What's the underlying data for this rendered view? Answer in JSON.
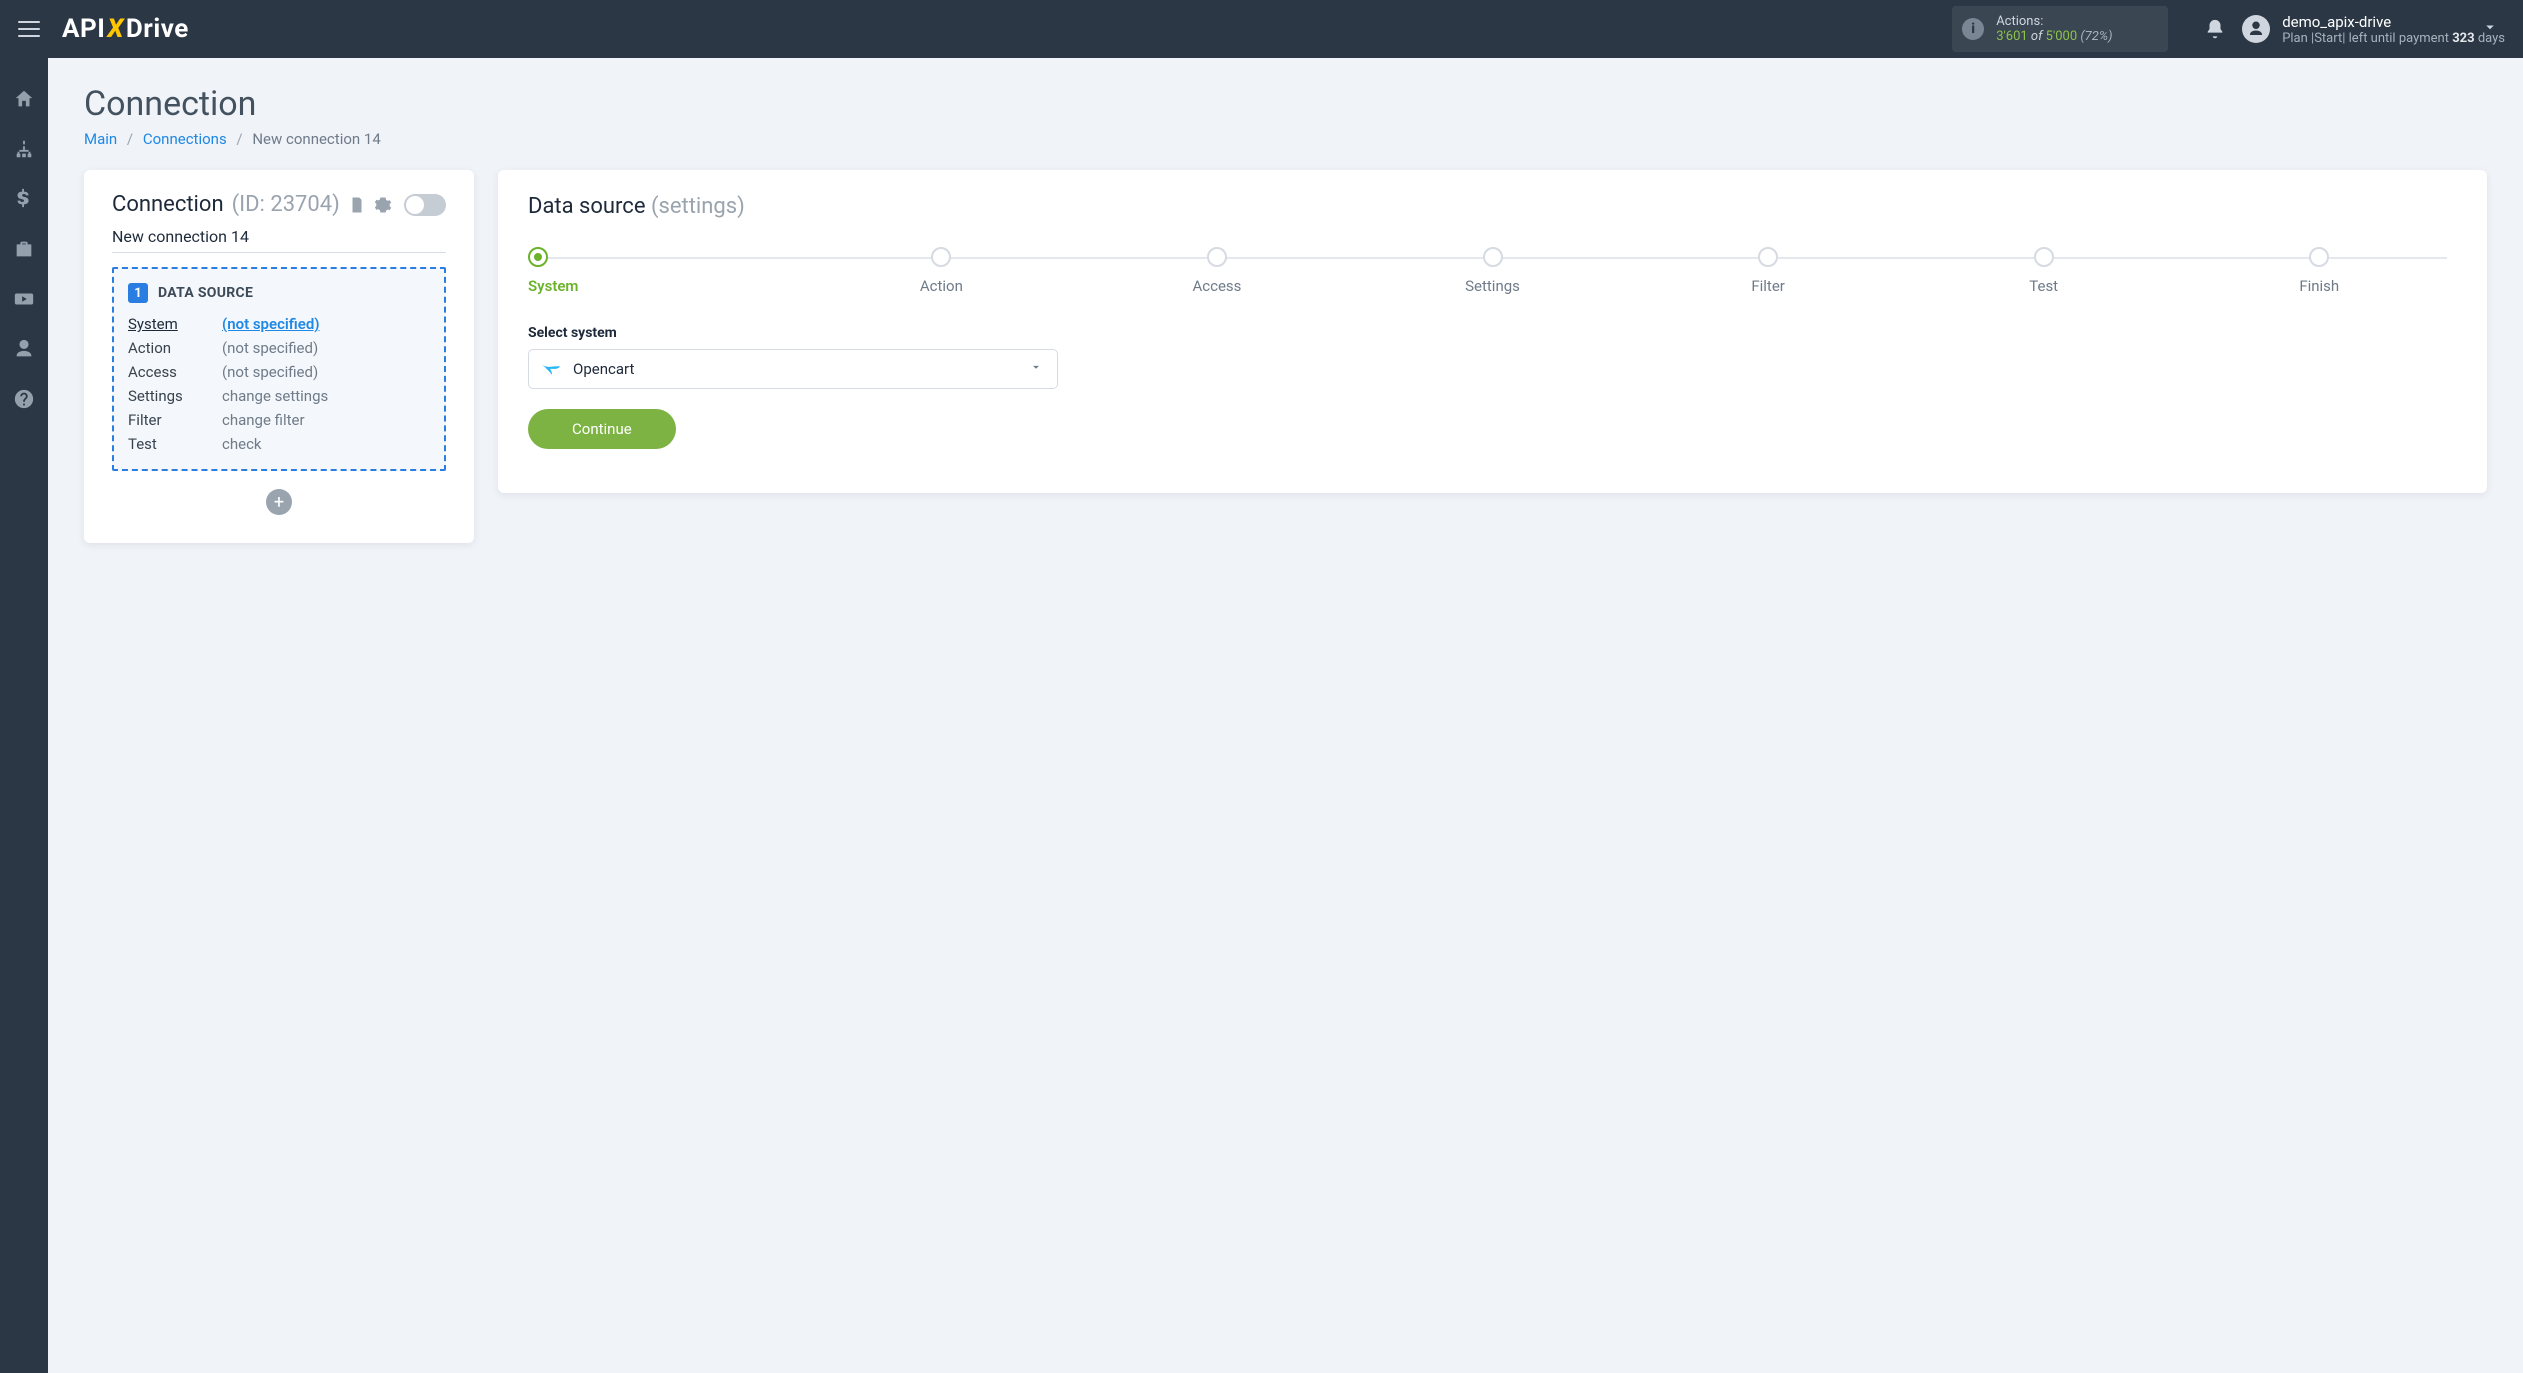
{
  "topbar": {
    "logo_prefix": "API",
    "logo_x": "X",
    "logo_suffix": "Drive",
    "actions_label": "Actions:",
    "actions_used": "3'601",
    "actions_of": " of ",
    "actions_limit": "5'000",
    "actions_pct": " (72%)",
    "user_name": "demo_apix-drive",
    "user_plan_prefix": "Plan |Start| left until payment ",
    "user_plan_days": "323",
    "user_plan_suffix": " days"
  },
  "page": {
    "title": "Connection",
    "crumb_main": "Main",
    "crumb_connections": "Connections",
    "crumb_current": "New connection 14"
  },
  "connection_card": {
    "title": "Connection",
    "id_text": "(ID: 23704)",
    "name": "New connection 14",
    "datasource_num": "1",
    "datasource_label": "DATA SOURCE",
    "rows": {
      "system_k": "System",
      "system_v": "(not specified)",
      "action_k": "Action",
      "action_v": "(not specified)",
      "access_k": "Access",
      "access_v": "(not specified)",
      "settings_k": "Settings",
      "settings_v": "change settings",
      "filter_k": "Filter",
      "filter_v": "change filter",
      "test_k": "Test",
      "test_v": "check"
    },
    "add_btn": "+"
  },
  "source_card": {
    "title": "Data source",
    "subtitle": "(settings)",
    "steps": [
      "System",
      "Action",
      "Access",
      "Settings",
      "Filter",
      "Test",
      "Finish"
    ],
    "select_label": "Select system",
    "select_value": "Opencart",
    "continue_label": "Continue"
  }
}
